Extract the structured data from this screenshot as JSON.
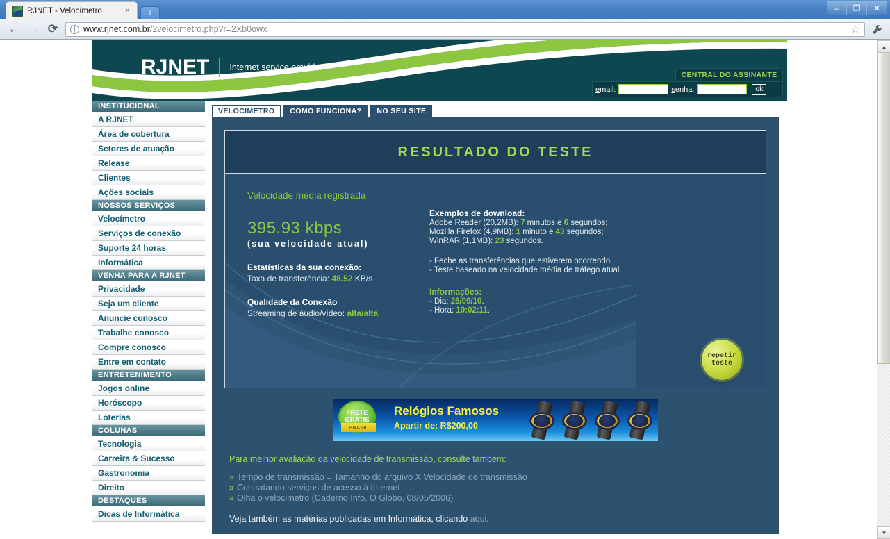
{
  "browser": {
    "tab_title": "RJNET - Velocímetro",
    "tab_close": "×",
    "new_tab": "+",
    "back": "←",
    "forward": "→",
    "reload": "⟳",
    "url_domain": "www.rjnet.com.br",
    "url_path": "/2velocimetro.php?r=2Xb0owx",
    "bookmark": "☆",
    "menu": "🔧",
    "minimize": "–",
    "restore": "❐",
    "close": "✕"
  },
  "header": {
    "logo": "RJNET",
    "tagline": "Internet service provider",
    "central_label": "CENTRAL DO ASSINANTE",
    "email_label": "email:",
    "senha_label": "senha:",
    "email_value": "",
    "senha_value": "",
    "ok_label": "ok",
    "colors": {
      "teal": "#0f4750",
      "green": "#8dc63f",
      "light_green": "#a5d94f"
    }
  },
  "sidebar": {
    "sections": [
      {
        "title": "INSTITUCIONAL",
        "items": [
          "A RJNET",
          "Área de cobertura",
          "Setores de atuação",
          "Release",
          "Clientes",
          "Ações sociais"
        ]
      },
      {
        "title": "NOSSOS SERVIÇOS",
        "items": [
          "Velocímetro",
          "Serviços de conexão",
          "Suporte 24 horas",
          "Informática"
        ]
      },
      {
        "title": "VENHA PARA A RJNET",
        "items": [
          "Privacidade",
          "Seja um cliente",
          "Anuncie conosco",
          "Trabalhe conosco",
          "Compre conosco",
          "Entre em contato"
        ]
      },
      {
        "title": "ENTRETENIMENTO",
        "items": [
          "Jogos online",
          "Horóscopo",
          "Loterias"
        ]
      },
      {
        "title": "COLUNAS",
        "items": [
          "Tecnologia",
          "Carreira & Sucesso",
          "Gastronomia",
          "Direito"
        ]
      },
      {
        "title": "DESTAQUES",
        "items": [
          "Dicas de Informática"
        ]
      }
    ]
  },
  "tabs": [
    {
      "label": "VELOCIMETRO",
      "active": true
    },
    {
      "label": "COMO FUNCIONA?",
      "active": false
    },
    {
      "label": "NO SEU SITE",
      "active": false
    }
  ],
  "result": {
    "title": "RESULTADO DO TESTE",
    "avg_label": "Velocidade média registrada",
    "speed_value": "395.93 kbps",
    "speed_caption": "(sua velocidade atual)",
    "stats_head": "Estatísticas da sua conexão:",
    "transfer_label": "Taxa de transferência:",
    "transfer_value": "48.52",
    "transfer_unit": "KB/s",
    "quality_head": "Qualidade da Conexão",
    "quality_label": "Streaming de áudio/vídeo:",
    "quality_value": "alta/alta",
    "examples_head": "Exemplos de download:",
    "examples": [
      {
        "name": "Adobe Reader (20,2MB):",
        "n1": "7",
        "mid": "minutos e",
        "n2": "6",
        "tail": "segundos;"
      },
      {
        "name": "Mozilla Firefox (4,9MB):",
        "n1": "1",
        "mid": "minuto e",
        "n2": "43",
        "tail": "segundos;"
      },
      {
        "name": "WinRAR (1,1MB):",
        "n1": "23",
        "mid": "",
        "n2": "",
        "tail": "segundos."
      }
    ],
    "notes": [
      "- Feche as transferências que estiverem ocorrendo.",
      "- Teste baseado na velocidade média de tráfego atual."
    ],
    "info_head": "Informações:",
    "info_day_label": "- Dia:",
    "info_day_value": "25/09/10",
    "info_time_label": "- Hora:",
    "info_time_value": "10:02:11",
    "repeat_line1": "repetir",
    "repeat_line2": "teste"
  },
  "banner": {
    "seal_line1": "FRETE",
    "seal_line2": "GRATIS",
    "seal_ribbon": "BRASIL",
    "title": "Relógios Famosos",
    "subtitle": "Apartir de: R$200,00"
  },
  "footer": {
    "intro": "Para melhor avaliação da velocidade de transmissão, consulte também:",
    "bullet": "»",
    "links": [
      "Tempo de transmissão = Tamanho do arquivo X Velocidade de transmissão",
      "Contratando serviços de acesso à Internet",
      "Olha o velocimetro (Caderno Info, O Globo, 08/05/2006)"
    ],
    "tail_pre": "Veja também as matérias publicadas em Informática, clicando ",
    "tail_link": "aqui",
    "tail_post": "."
  },
  "scrollbar": {
    "up": "▲",
    "down": "▼"
  }
}
